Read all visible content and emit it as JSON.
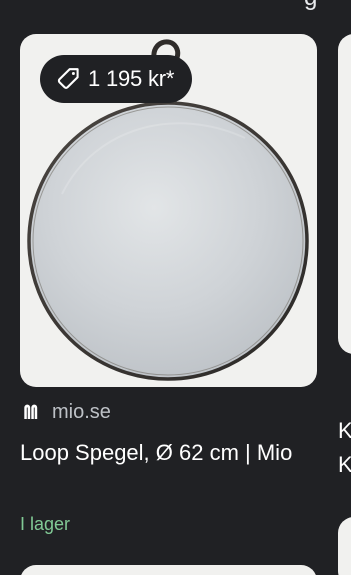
{
  "results": {
    "primary": {
      "price": "1 195 kr*",
      "source": "mio.se",
      "title": "Loop Spegel, Ø 62 cm | Mio",
      "stock": "I lager",
      "icons": {
        "price_icon": "price-tag-icon",
        "source_icon": "mio-logo-icon"
      }
    },
    "next": {
      "line_1": "K",
      "line_2": "K"
    }
  },
  "colors": {
    "background": "#202124",
    "card_image_background": "#f1f1ef",
    "stock_status": "#81c995",
    "muted_text": "#bdc1c6",
    "primary_text": "#ffffff"
  }
}
